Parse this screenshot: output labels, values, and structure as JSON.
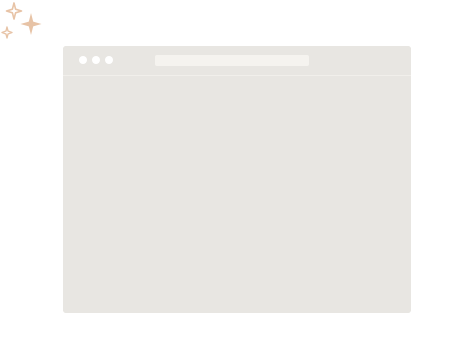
{
  "decor": {
    "icon": "sparkles-icon",
    "color": "#e7c3a6"
  },
  "window": {
    "background": "#e8e6e2",
    "titlebar": {
      "controls": [
        "close-dot",
        "minimize-dot",
        "maximize-dot"
      ],
      "control_color": "#ffffff",
      "address_bar": {
        "value": "",
        "background": "#f5f3ef"
      }
    },
    "content": {
      "text": ""
    }
  }
}
